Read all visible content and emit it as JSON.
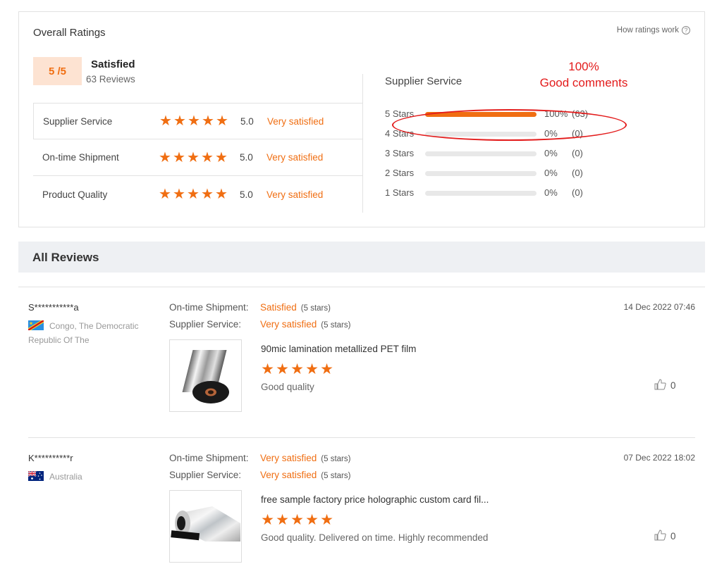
{
  "overall": {
    "title": "Overall Ratings",
    "how_link": "How ratings work",
    "help_glyph": "?",
    "score": "5 /5",
    "score_label": "Satisfied",
    "reviews_count": "63 Reviews",
    "metrics": [
      {
        "name": "Supplier Service",
        "score": "5.0",
        "word": "Very satisfied",
        "stars": 5
      },
      {
        "name": "On-time Shipment",
        "score": "5.0",
        "word": "Very satisfied",
        "stars": 5
      },
      {
        "name": "Product Quality",
        "score": "5.0",
        "word": "Very satisfied",
        "stars": 5
      }
    ]
  },
  "distribution": {
    "title": "Supplier Service",
    "annotation_line1": "100%",
    "annotation_line2": "Good comments",
    "rows": [
      {
        "label": "5 Stars",
        "pct": "100%",
        "count": "(63)",
        "fraction": 1.0
      },
      {
        "label": "4 Stars",
        "pct": "0%",
        "count": "(0)",
        "fraction": 0
      },
      {
        "label": "3 Stars",
        "pct": "0%",
        "count": "(0)",
        "fraction": 0
      },
      {
        "label": "2 Stars",
        "pct": "0%",
        "count": "(0)",
        "fraction": 0
      },
      {
        "label": "1 Stars",
        "pct": "0%",
        "count": "(0)",
        "fraction": 0
      }
    ]
  },
  "reviews": {
    "header": "All Reviews",
    "items": [
      {
        "user": "S***********a",
        "country": "Congo, The Democratic Republic Of The",
        "flag": "congo-flag",
        "shipment_label": "On-time Shipment:",
        "shipment_word": "Satisfied",
        "shipment_stars": "(5 stars)",
        "service_label": "Supplier Service:",
        "service_word": "Very satisfied",
        "service_stars": "(5 stars)",
        "date": "14 Dec 2022 07:46",
        "product_title": "90mic lamination metallized PET film",
        "product_stars": 5,
        "comment": "Good quality",
        "likes": "0"
      },
      {
        "user": "K**********r",
        "country": "Australia",
        "flag": "australia-flag",
        "shipment_label": "On-time Shipment:",
        "shipment_word": "Very satisfied",
        "shipment_stars": "(5 stars)",
        "service_label": "Supplier Service:",
        "service_word": "Very satisfied",
        "service_stars": "(5 stars)",
        "date": "07 Dec 2022 18:02",
        "product_title": "free sample factory price holographic custom card fil...",
        "product_stars": 5,
        "comment": "Good quality. Delivered on time. Highly recommended",
        "likes": "0"
      }
    ]
  },
  "colors": {
    "accent": "#f06e12",
    "annotation": "#e31b1b",
    "header_bg": "#eef0f3"
  }
}
